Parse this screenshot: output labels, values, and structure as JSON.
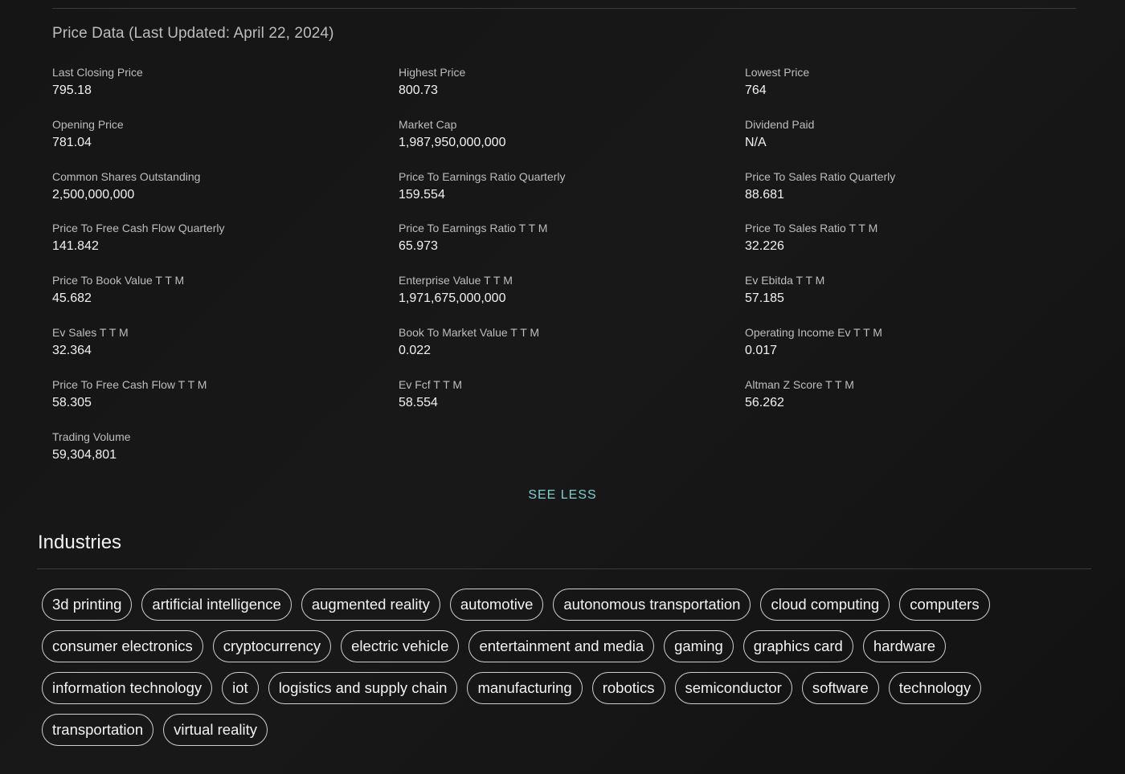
{
  "price_section": {
    "title": "Price Data (Last Updated: April 22, 2024)",
    "metrics": [
      {
        "label": "Last Closing Price",
        "value": "795.18"
      },
      {
        "label": "Highest Price",
        "value": "800.73"
      },
      {
        "label": "Lowest Price",
        "value": "764"
      },
      {
        "label": "Opening Price",
        "value": "781.04"
      },
      {
        "label": "Market Cap",
        "value": "1,987,950,000,000"
      },
      {
        "label": "Dividend Paid",
        "value": "N/A"
      },
      {
        "label": "Common Shares Outstanding",
        "value": "2,500,000,000"
      },
      {
        "label": "Price To Earnings Ratio Quarterly",
        "value": "159.554"
      },
      {
        "label": "Price To Sales Ratio Quarterly",
        "value": "88.681"
      },
      {
        "label": "Price To Free Cash Flow Quarterly",
        "value": "141.842"
      },
      {
        "label": "Price To Earnings Ratio T T M",
        "value": "65.973"
      },
      {
        "label": "Price To Sales Ratio T T M",
        "value": "32.226"
      },
      {
        "label": "Price To Book Value T T M",
        "value": "45.682"
      },
      {
        "label": "Enterprise Value T T M",
        "value": "1,971,675,000,000"
      },
      {
        "label": "Ev Ebitda T T M",
        "value": "57.185"
      },
      {
        "label": "Ev Sales T T M",
        "value": "32.364"
      },
      {
        "label": "Book To Market Value T T M",
        "value": "0.022"
      },
      {
        "label": "Operating Income Ev T T M",
        "value": "0.017"
      },
      {
        "label": "Price To Free Cash Flow T T M",
        "value": "58.305"
      },
      {
        "label": "Ev Fcf T T M",
        "value": "58.554"
      },
      {
        "label": "Altman Z Score T T M",
        "value": "56.262"
      },
      {
        "label": "Trading Volume",
        "value": "59,304,801"
      }
    ],
    "see_less_label": "SEE LESS"
  },
  "industries": {
    "title": "Industries",
    "rows": [
      [
        "3d printing",
        "artificial intelligence",
        "augmented reality",
        "automotive",
        "autonomous transportation",
        "cloud computing",
        "computers"
      ],
      [
        "consumer electronics",
        "cryptocurrency",
        "electric vehicle",
        "entertainment and media",
        "gaming",
        "graphics card",
        "hardware"
      ],
      [
        "information technology",
        "iot",
        "logistics and supply chain",
        "manufacturing",
        "robotics",
        "semiconductor",
        "software",
        "technology"
      ],
      [
        "transportation",
        "virtual reality"
      ]
    ]
  },
  "colors": {
    "background": "#161616",
    "accent_link": "#7fcfcf",
    "chip_border": "#cfcfcf"
  }
}
